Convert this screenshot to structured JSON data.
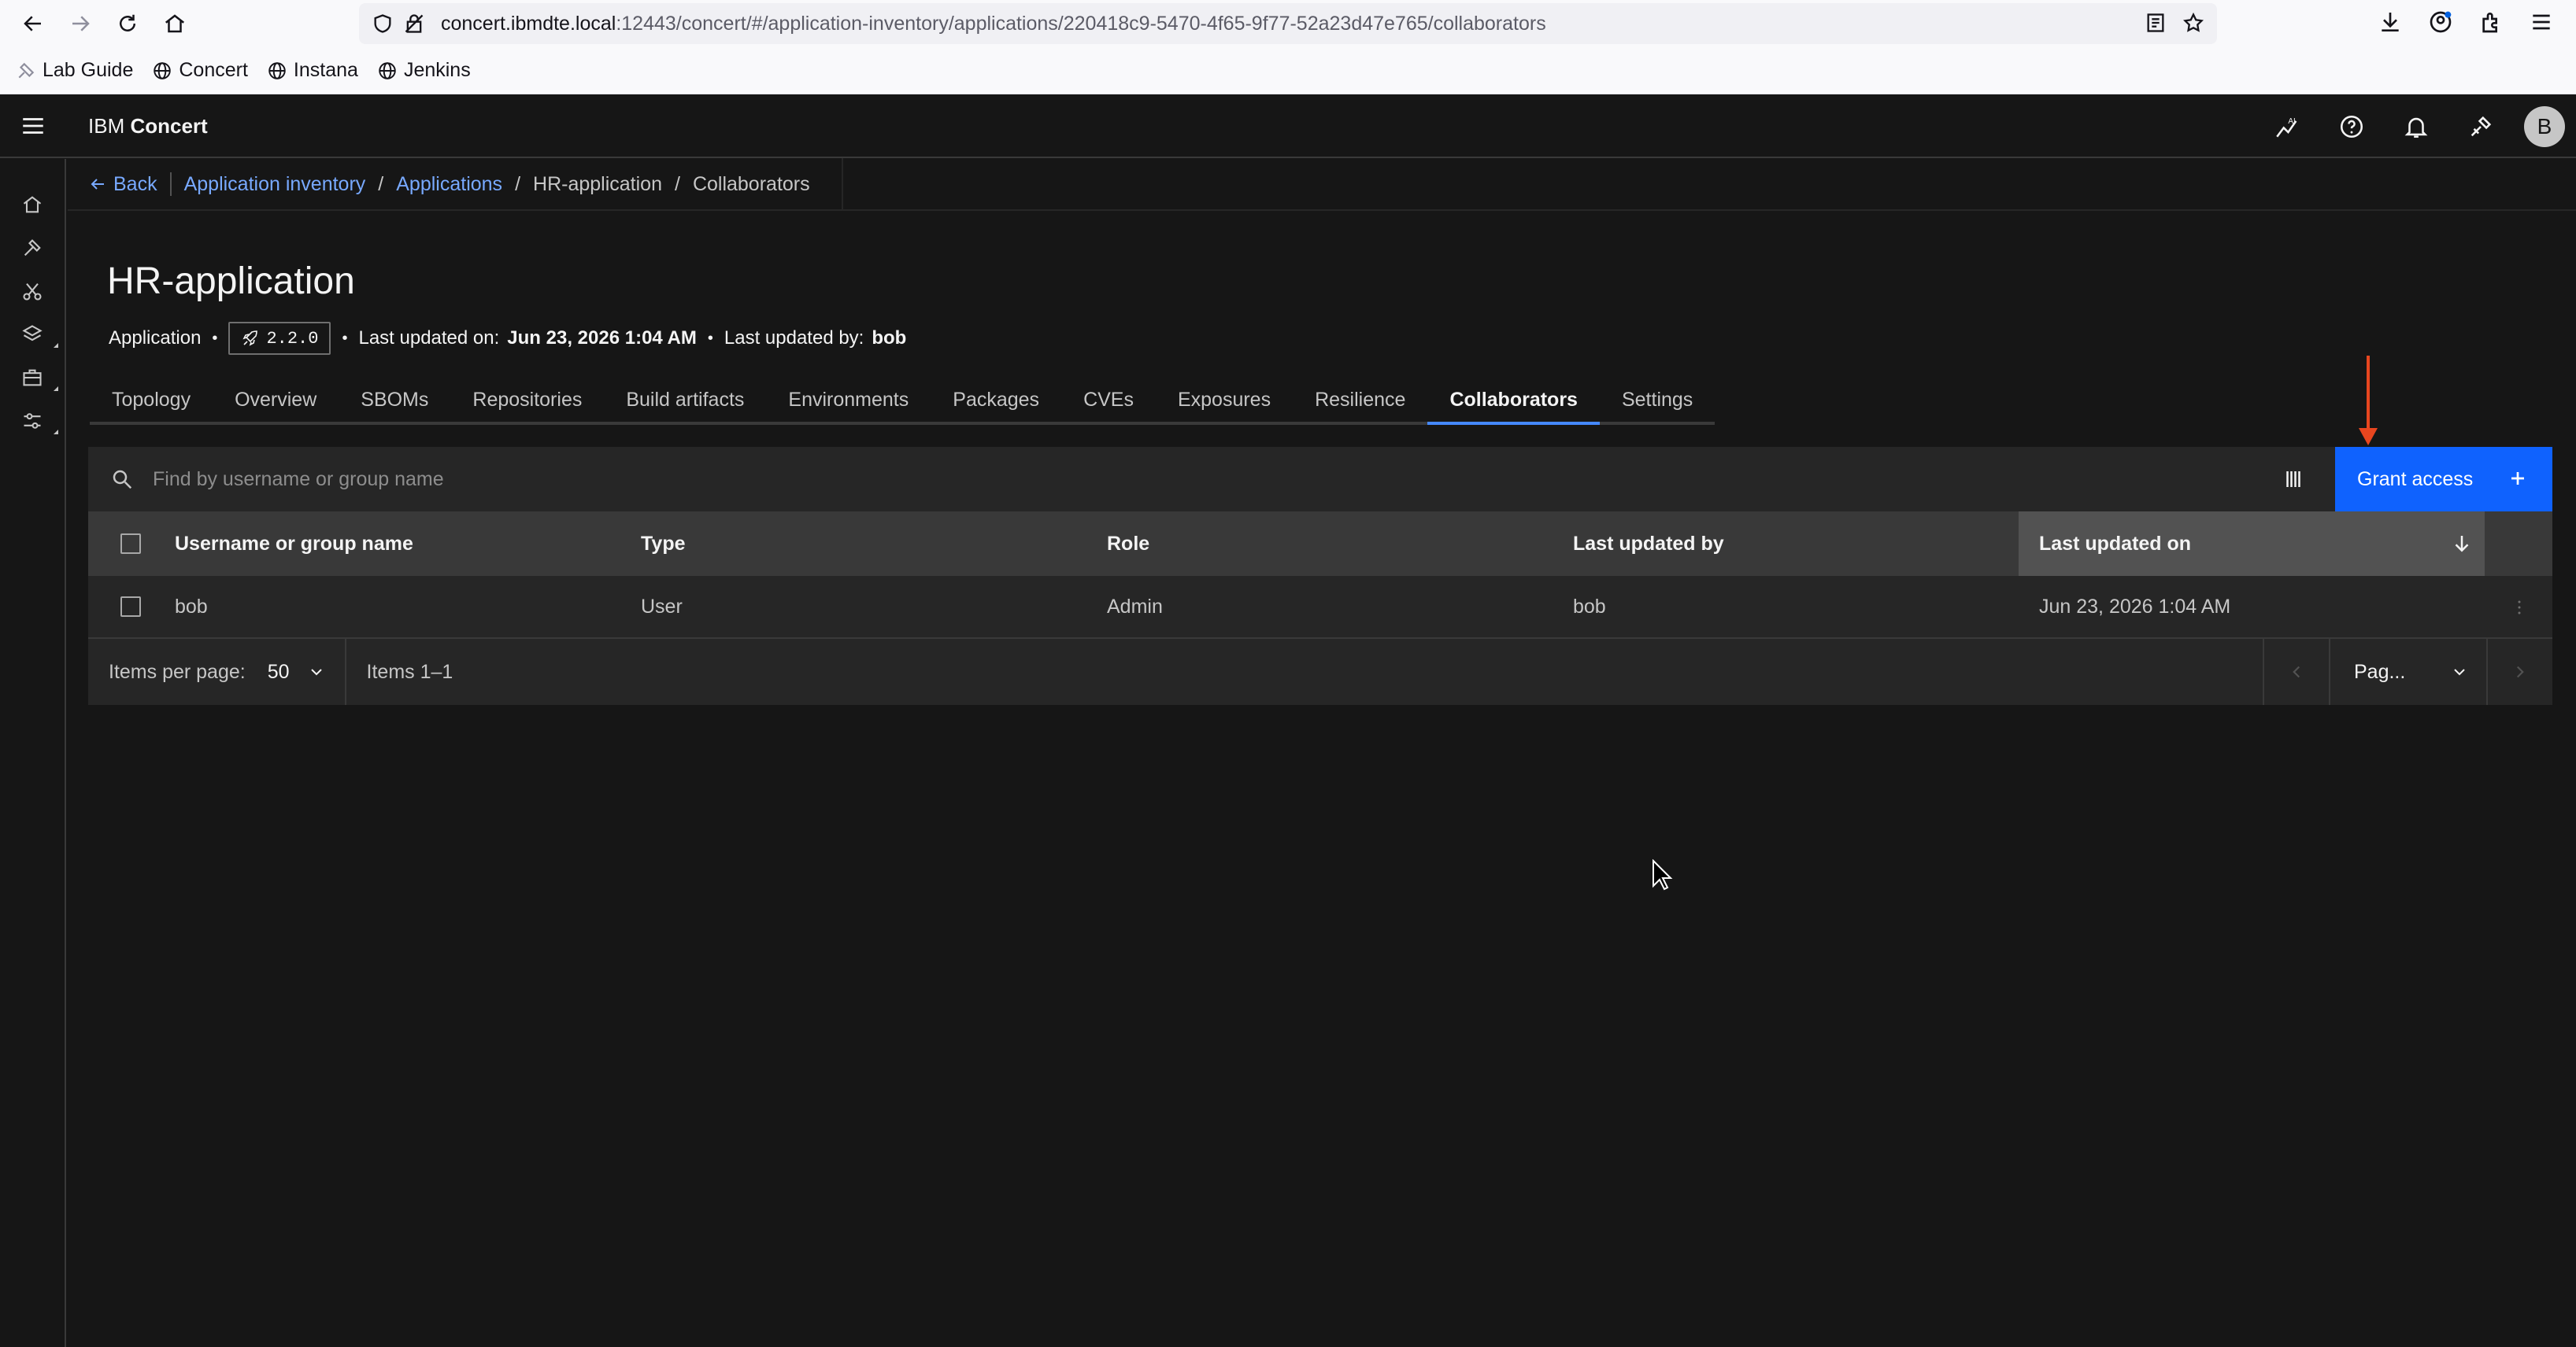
{
  "browser": {
    "url_host": "concert.ibmdte.local",
    "url_rest": ":12443/concert/#/application-inventory/applications/220418c9-5470-4f65-9f77-52a23d47e765/collaborators",
    "bookmarks": [
      "Lab Guide",
      "Concert",
      "Instana",
      "Jenkins"
    ]
  },
  "app": {
    "brand": "IBM",
    "product": "Concert",
    "avatar_initial": "B",
    "accent": "#0f62fe"
  },
  "breadcrumb": {
    "back": "Back",
    "items": [
      "Application inventory",
      "Applications",
      "HR-application",
      "Collaborators"
    ]
  },
  "page": {
    "title": "HR-application",
    "type": "Application",
    "version": "2.2.0",
    "last_updated_on_label": "Last updated on:",
    "last_updated_on": "Jun 23, 2026 1:04 AM",
    "last_updated_by_label": "Last updated by:",
    "last_updated_by": "bob"
  },
  "tabs": [
    {
      "label": "Topology"
    },
    {
      "label": "Overview"
    },
    {
      "label": "SBOMs"
    },
    {
      "label": "Repositories"
    },
    {
      "label": "Build artifacts"
    },
    {
      "label": "Environments"
    },
    {
      "label": "Packages"
    },
    {
      "label": "CVEs"
    },
    {
      "label": "Exposures"
    },
    {
      "label": "Resilience"
    },
    {
      "label": "Collaborators",
      "active": true
    },
    {
      "label": "Settings"
    }
  ],
  "toolbar": {
    "search_placeholder": "Find by username or group name",
    "grant_label": "Grant access"
  },
  "table": {
    "columns": [
      "Username or group name",
      "Type",
      "Role",
      "Last updated by",
      "Last updated on"
    ],
    "sorted_column": "Last updated on",
    "rows": [
      {
        "name": "bob",
        "type": "User",
        "role": "Admin",
        "updated_by": "bob",
        "updated_on": "Jun 23, 2026 1:04 AM"
      }
    ]
  },
  "pagination": {
    "items_per_page_label": "Items per page:",
    "items_per_page": "50",
    "items_range": "Items 1–1",
    "page_label": "Pag..."
  }
}
